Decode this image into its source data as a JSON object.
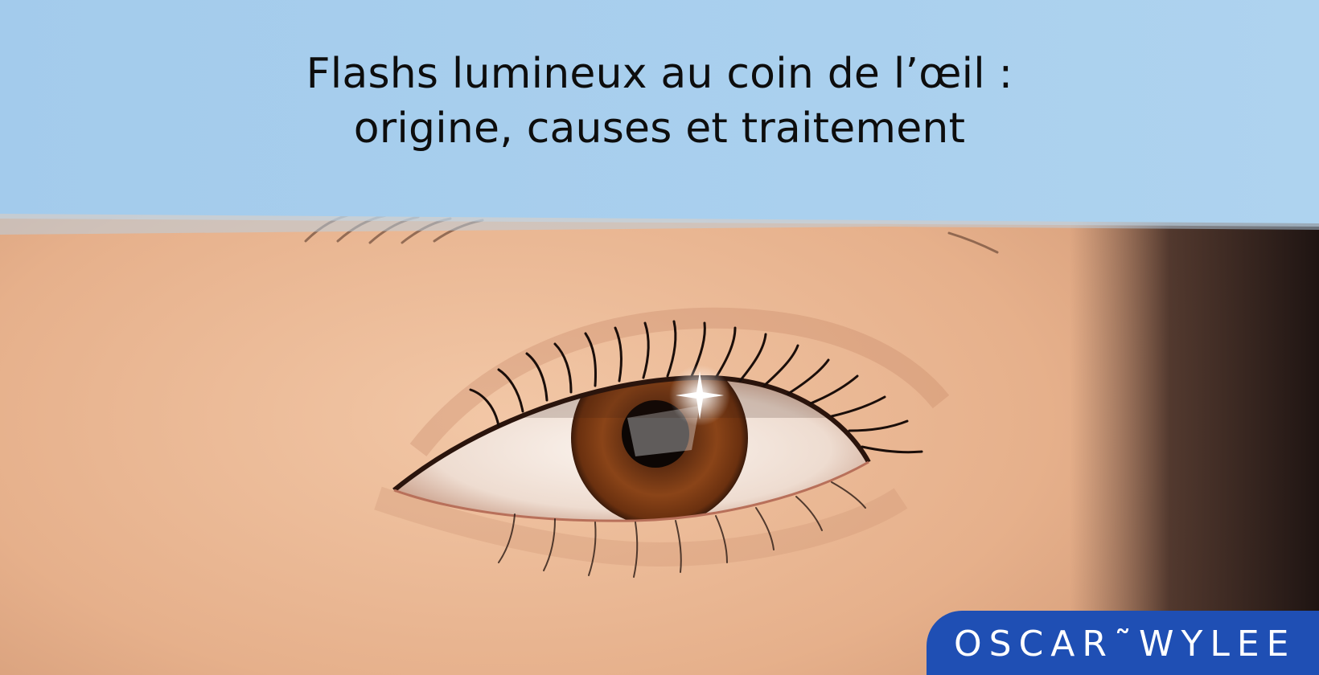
{
  "title": {
    "line1": "Flashs lumineux au coin de l’œil :",
    "line2": "origine, causes et traitement"
  },
  "brand": {
    "logo_text": "OSCAR˜WYLEE",
    "badge_color": "#1f4fb4"
  },
  "colors": {
    "header_blue": "#a7cfee",
    "skin": "#e7b48f",
    "iris": "#7a3a14"
  }
}
